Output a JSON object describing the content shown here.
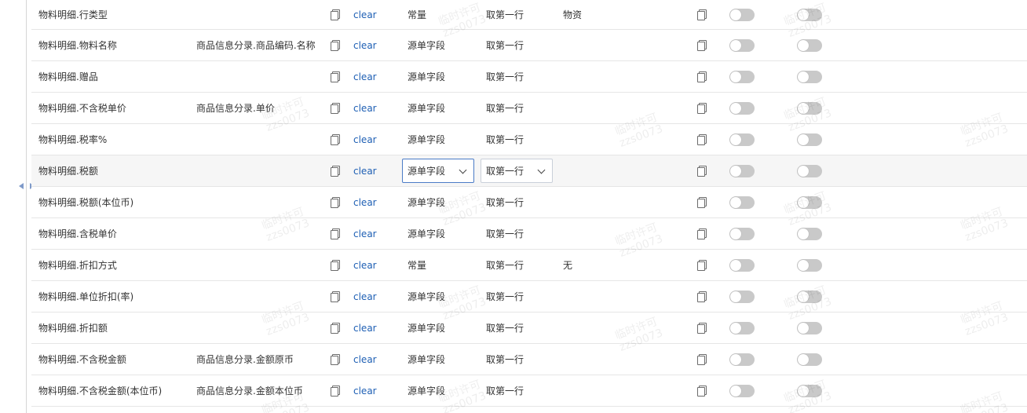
{
  "watermark": {
    "line1": "临时许可",
    "line2": "zzs0073"
  },
  "clear_label": "clear",
  "rows": [
    {
      "field": "物料明细.行类型",
      "source": "",
      "type": "常量",
      "take": "取第一行",
      "value": "物资"
    },
    {
      "field": "物料明细.物料名称",
      "source": "商品信息分录.商品编码.名称",
      "type": "源单字段",
      "take": "取第一行",
      "value": ""
    },
    {
      "field": "物料明细.赠品",
      "source": "",
      "type": "源单字段",
      "take": "取第一行",
      "value": ""
    },
    {
      "field": "物料明细.不含税单价",
      "source": "商品信息分录.单价",
      "type": "源单字段",
      "take": "取第一行",
      "value": ""
    },
    {
      "field": "物料明细.税率%",
      "source": "",
      "type": "源单字段",
      "take": "取第一行",
      "value": ""
    },
    {
      "field": "物料明细.税额",
      "source": "",
      "type": "源单字段",
      "take": "取第一行",
      "value": "",
      "editing": true
    },
    {
      "field": "物料明细.税额(本位币)",
      "source": "",
      "type": "源单字段",
      "take": "取第一行",
      "value": ""
    },
    {
      "field": "物料明细.含税单价",
      "source": "",
      "type": "源单字段",
      "take": "取第一行",
      "value": ""
    },
    {
      "field": "物料明细.折扣方式",
      "source": "",
      "type": "常量",
      "take": "取第一行",
      "value": "无"
    },
    {
      "field": "物料明细.单位折扣(率)",
      "source": "",
      "type": "源单字段",
      "take": "取第一行",
      "value": ""
    },
    {
      "field": "物料明细.折扣额",
      "source": "",
      "type": "源单字段",
      "take": "取第一行",
      "value": ""
    },
    {
      "field": "物料明细.不含税金额",
      "source": "商品信息分录.金额原币",
      "type": "源单字段",
      "take": "取第一行",
      "value": ""
    },
    {
      "field": "物料明细.不含税金额(本位币)",
      "source": "商品信息分录.金额本位币",
      "type": "源单字段",
      "take": "取第一行",
      "value": ""
    }
  ],
  "colors": {
    "link": "#1e5fb4",
    "toggle_off": "#c9c9c9",
    "focus_border": "#4b7cc7"
  }
}
